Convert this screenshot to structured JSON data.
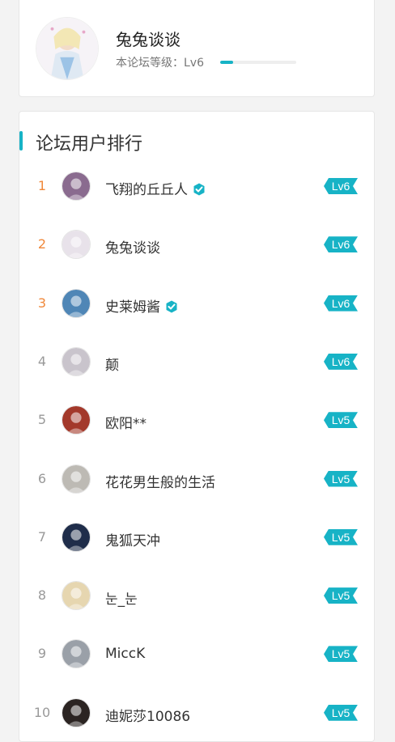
{
  "profile": {
    "name": "兔兔谈谈",
    "level_label": "本论坛等级：Lv6",
    "progress": 0.17
  },
  "ranking": {
    "title": "论坛用户排行",
    "users": [
      {
        "rank": "1",
        "name": "飞翔的丘丘人",
        "verified": true,
        "level": "Lv6",
        "avatar_color": "#8a6b8f"
      },
      {
        "rank": "2",
        "name": "兔兔谈谈",
        "verified": false,
        "level": "Lv6",
        "avatar_color": "#e8e2ea"
      },
      {
        "rank": "3",
        "name": "史莱姆酱",
        "verified": true,
        "level": "Lv6",
        "avatar_color": "#4f86b6"
      },
      {
        "rank": "4",
        "name": "颠",
        "verified": false,
        "level": "Lv6",
        "avatar_color": "#c9c4cc"
      },
      {
        "rank": "5",
        "name": "欧阳**",
        "verified": false,
        "level": "Lv5",
        "avatar_color": "#a3392b"
      },
      {
        "rank": "6",
        "name": "花花男生般的生活",
        "verified": false,
        "level": "Lv5",
        "avatar_color": "#bdbab4"
      },
      {
        "rank": "7",
        "name": "鬼狐天冲",
        "verified": false,
        "level": "Lv5",
        "avatar_color": "#1f2d4a"
      },
      {
        "rank": "8",
        "name": "눈_눈",
        "verified": false,
        "level": "Lv5",
        "avatar_color": "#e6d6b0"
      },
      {
        "rank": "9",
        "name": "MiccK",
        "verified": false,
        "level": "Lv5",
        "avatar_color": "#9aa0a8"
      },
      {
        "rank": "10",
        "name": "迪妮莎10086",
        "verified": false,
        "level": "Lv5",
        "avatar_color": "#2b2422"
      }
    ]
  },
  "colors": {
    "accent": "#17b3c6",
    "top_rank": "#f0883a",
    "verified": "#17b3c6"
  }
}
